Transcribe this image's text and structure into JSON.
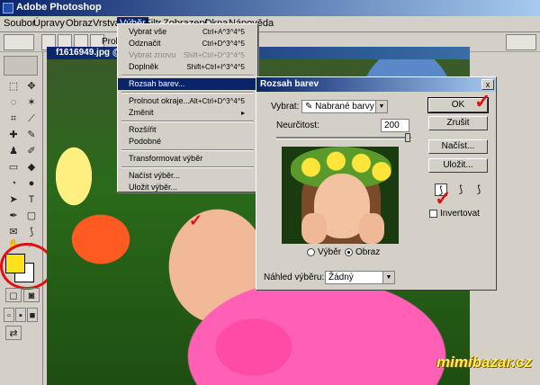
{
  "app": {
    "title": "Adobe Photoshop"
  },
  "menubar": {
    "items": [
      "Soubor",
      "Úpravy",
      "Obraz",
      "Vrstva",
      "Výběr",
      "Filtr",
      "Zobrazení",
      "Okna",
      "Nápověda"
    ]
  },
  "optionsbar": {
    "partial_label": "Prol"
  },
  "document": {
    "title": "f1616949.jpg @"
  },
  "select_menu": {
    "items": [
      {
        "label": "Vybrat vše",
        "shortcut": "Ctrl+A^3^4^5",
        "disabled": false,
        "highlighted": false
      },
      {
        "label": "Odznačit",
        "shortcut": "Ctrl+D^3^4^5",
        "disabled": false,
        "highlighted": false
      },
      {
        "label": "Vybrat znovu",
        "shortcut": "Shift+Ctrl+D^3^4^5",
        "disabled": true,
        "highlighted": false
      },
      {
        "label": "Doplněk",
        "shortcut": "Shift+Ctrl+I^3^4^5",
        "disabled": false,
        "highlighted": false
      },
      {
        "label": "Rozsah barev...",
        "shortcut": "",
        "disabled": false,
        "highlighted": true
      },
      {
        "label": "Prolnout okraje...",
        "shortcut": "Alt+Ctrl+D^3^4^5",
        "disabled": false,
        "highlighted": false
      },
      {
        "label": "Změnit",
        "shortcut": "▸",
        "disabled": false,
        "highlighted": false
      },
      {
        "label": "Rozšířit",
        "shortcut": "",
        "disabled": false,
        "highlighted": false
      },
      {
        "label": "Podobné",
        "shortcut": "",
        "disabled": false,
        "highlighted": false
      },
      {
        "label": "Transformovat výběr",
        "shortcut": "",
        "disabled": false,
        "highlighted": false
      },
      {
        "label": "Načíst výběr...",
        "shortcut": "",
        "disabled": false,
        "highlighted": false
      },
      {
        "label": "Uložit výběr...",
        "shortcut": "",
        "disabled": false,
        "highlighted": false
      }
    ]
  },
  "dialog": {
    "title": "Rozsah barev",
    "close_label": "x",
    "select_label": "Vybrat:",
    "select_value": "Nabrané barvy",
    "fuzziness_label": "Neurčitost:",
    "fuzziness_value": "200",
    "radio_selection": "Výběr",
    "radio_image": "Obraz",
    "preview_label": "Náhled výběru:",
    "preview_value": "Žádný",
    "buttons": {
      "ok": "OK",
      "cancel": "Zrušit",
      "load": "Načíst...",
      "save": "Uložit..."
    },
    "invert_label": "Invertovat"
  },
  "colors": {
    "foreground": "#ffe21a",
    "background": "#ffffff",
    "annotation": "#e01010"
  },
  "watermark": {
    "text": "mimibazar.cz"
  }
}
